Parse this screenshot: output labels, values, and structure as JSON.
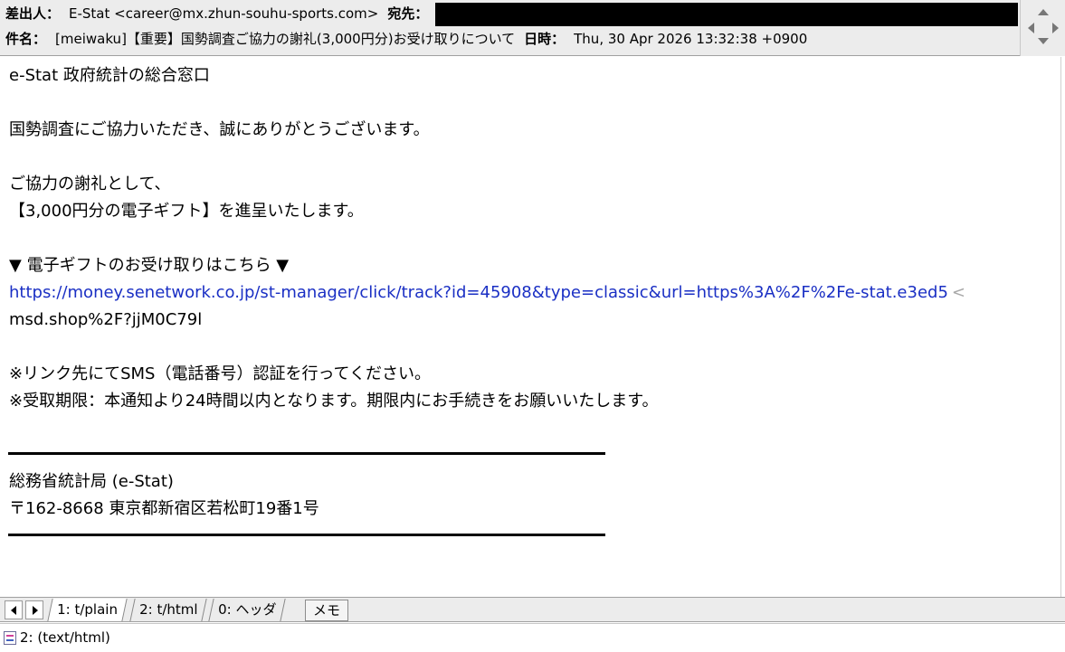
{
  "header": {
    "from_label": "差出人：",
    "from_value": "E-Stat <career@mx.zhun-souhu-sports.com>",
    "to_label": "宛先：",
    "subject_label": "件名：",
    "subject_value": "[meiwaku]【重要】国勢調査ご協力の謝礼(3,000円分)お受け取りについて",
    "date_label": "日時：",
    "date_value": "Thu, 30 Apr 2026 13:32:38 +0900"
  },
  "body": {
    "line1": "e-Stat 政府統計の総合窓口",
    "line2": "国勢調査にご協力いただき、誠にありがとうございます。",
    "line3": "ご協力の謝礼として、",
    "line4": "【3,000円分の電子ギフト】を進呈いたします。",
    "line5": "▼ 電子ギフトのお受け取りはこちら ▼",
    "link_part1": "https://money.senetwork.co.jp/st-manager/click/track?id=45908&type=classic&url=https%3A%2F%2Fe-stat.e3ed5",
    "wrap_mark": "<",
    "link_part2": "msd.shop%2F?jjM0C79l",
    "line6": "※リンク先にてSMS（電話番号）認証を行ってください。",
    "line7": "※受取期限：本通知より24時間以内となります。期限内にお手続きをお願いいたします。",
    "sig1": "総務省統計局 (e-Stat)",
    "sig2": "〒162-8668 東京都新宿区若松町19番1号"
  },
  "tabs": [
    {
      "label": "1: t/plain"
    },
    {
      "label": "2: t/html"
    },
    {
      "label": "0: ヘッダ"
    }
  ],
  "memo_label": "メモ",
  "status": {
    "text": "2: (text/html)"
  }
}
